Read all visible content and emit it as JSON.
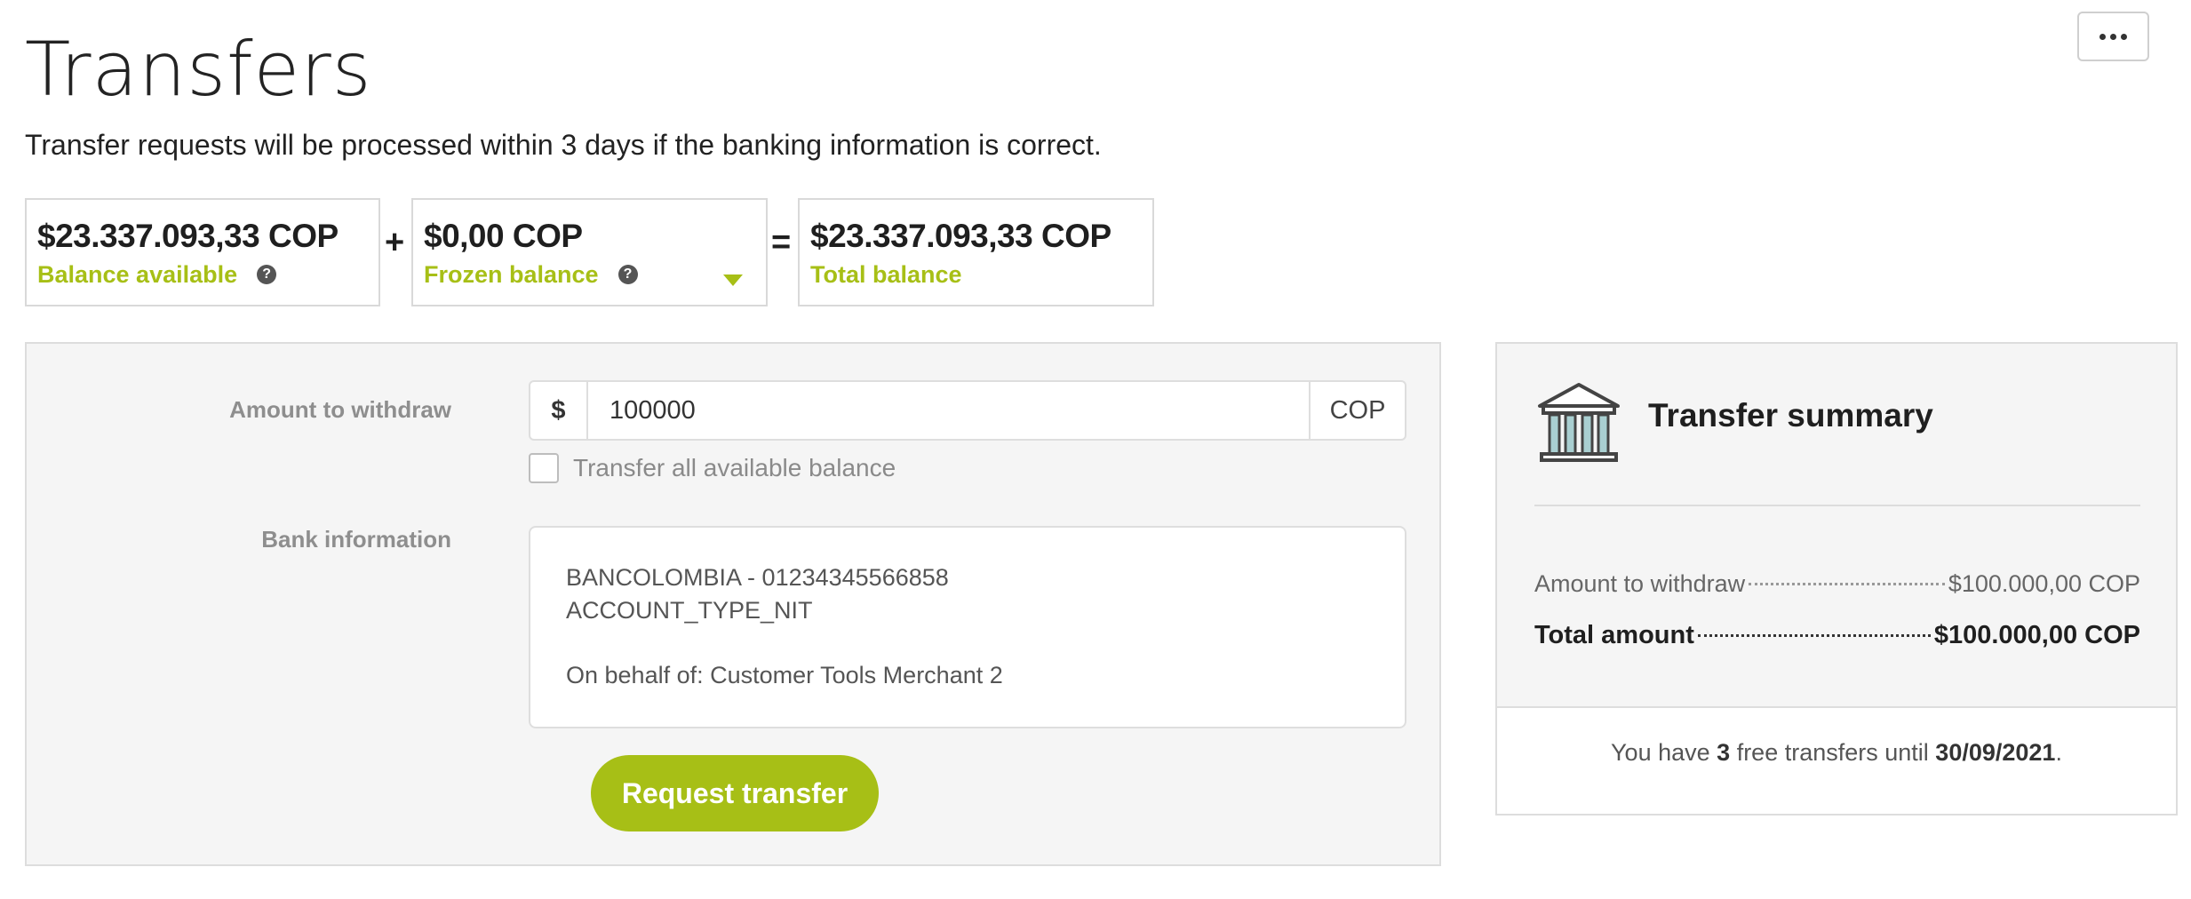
{
  "page": {
    "title": "Transfers",
    "subtitle": "Transfer requests will be processed within 3 days if the banking information is correct.",
    "more_icon": "ellipsis-icon"
  },
  "balances": {
    "available": {
      "amount": "$23.337.093,33 COP",
      "label": "Balance available",
      "help_icon": "question-circle-icon"
    },
    "plus": "+",
    "frozen": {
      "amount": "$0,00 COP",
      "label": "Frozen balance",
      "help_icon": "question-circle-icon",
      "expand_icon": "caret-down-icon"
    },
    "equals": "=",
    "total": {
      "amount": "$23.337.093,33 COP",
      "label": "Total balance"
    },
    "accent_color": "#a7bf16"
  },
  "form": {
    "amount_label": "Amount to withdraw",
    "currency_symbol": "$",
    "amount_value": "100000",
    "currency_code": "COP",
    "transfer_all_label": "Transfer all available balance",
    "transfer_all_checked": false,
    "bank_label": "Bank information",
    "bank": {
      "line1": "BANCOLOMBIA - 01234345566858",
      "line2": "ACCOUNT_TYPE_NIT",
      "line3": "On behalf of: Customer Tools Merchant 2"
    },
    "submit_label": "Request transfer"
  },
  "summary": {
    "icon": "bank-building-icon",
    "title": "Transfer summary",
    "rows": [
      {
        "label": "Amount to withdraw",
        "value": "$100.000,00 COP"
      },
      {
        "label": "Total amount",
        "value": "$100.000,00 COP"
      }
    ],
    "footer": {
      "prefix": "You have ",
      "count": "3",
      "middle": " free transfers until ",
      "date": "30/09/2021",
      "suffix": "."
    }
  }
}
